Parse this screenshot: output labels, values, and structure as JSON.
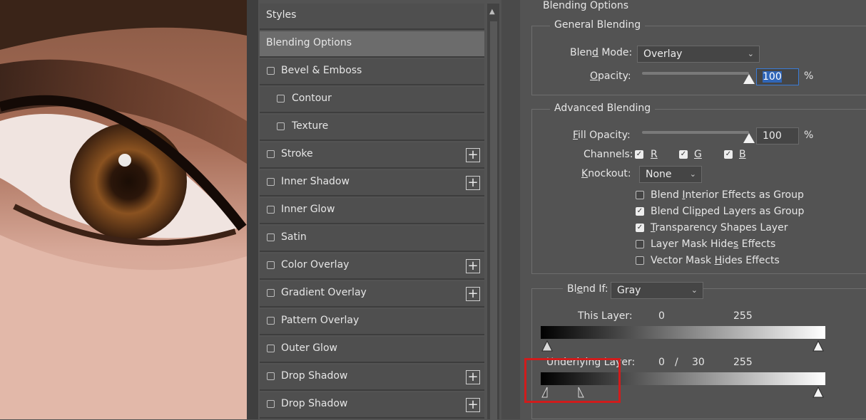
{
  "styles_list": {
    "items": [
      {
        "label": "Styles",
        "checkbox": false,
        "indent": false,
        "plus": false,
        "selected": false
      },
      {
        "label": "Blending Options",
        "checkbox": false,
        "indent": false,
        "plus": false,
        "selected": true
      },
      {
        "label": "Bevel & Emboss",
        "checkbox": true,
        "indent": false,
        "plus": false,
        "selected": false
      },
      {
        "label": "Contour",
        "checkbox": true,
        "indent": true,
        "plus": false,
        "selected": false
      },
      {
        "label": "Texture",
        "checkbox": true,
        "indent": true,
        "plus": false,
        "selected": false
      },
      {
        "label": "Stroke",
        "checkbox": true,
        "indent": false,
        "plus": true,
        "selected": false
      },
      {
        "label": "Inner Shadow",
        "checkbox": true,
        "indent": false,
        "plus": true,
        "selected": false
      },
      {
        "label": "Inner Glow",
        "checkbox": true,
        "indent": false,
        "plus": false,
        "selected": false
      },
      {
        "label": "Satin",
        "checkbox": true,
        "indent": false,
        "plus": false,
        "selected": false
      },
      {
        "label": "Color Overlay",
        "checkbox": true,
        "indent": false,
        "plus": true,
        "selected": false
      },
      {
        "label": "Gradient Overlay",
        "checkbox": true,
        "indent": false,
        "plus": true,
        "selected": false
      },
      {
        "label": "Pattern Overlay",
        "checkbox": true,
        "indent": false,
        "plus": false,
        "selected": false
      },
      {
        "label": "Outer Glow",
        "checkbox": true,
        "indent": false,
        "plus": false,
        "selected": false
      },
      {
        "label": "Drop Shadow",
        "checkbox": true,
        "indent": false,
        "plus": true,
        "selected": false
      },
      {
        "label": "Drop Shadow",
        "checkbox": true,
        "indent": false,
        "plus": true,
        "selected": false
      }
    ],
    "plus_symbol": "+"
  },
  "panel": {
    "title": "Blending Options",
    "general": {
      "legend": "General Blending",
      "blend_mode_label_pre": "Blen",
      "blend_mode_label_u": "d",
      "blend_mode_label_post": " Mode:",
      "blend_mode_value": "Overlay",
      "opacity_label_u": "O",
      "opacity_label_post": "pacity:",
      "opacity_value": "100",
      "opacity_unit": "%",
      "opacity_level": 1.0
    },
    "advanced": {
      "legend": "Advanced Blending",
      "fill_opacity_label_u": "F",
      "fill_opacity_label_post": "ill Opacity:",
      "fill_opacity_value": "100",
      "fill_opacity_unit": "%",
      "fill_opacity_level": 1.0,
      "channels_label": "Channels:",
      "channel_r": "R",
      "channel_g": "G",
      "channel_b": "B",
      "knockout_label_u": "K",
      "knockout_label_post": "nockout:",
      "knockout_value": "None",
      "options": [
        {
          "pre": "Blend ",
          "u": "I",
          "post": "nterior Effects as Group",
          "checked": false
        },
        {
          "pre": "Blend Cli",
          "u": "p",
          "post": "ped Layers as Group",
          "checked": true
        },
        {
          "pre": "",
          "u": "T",
          "post": "ransparency Shapes Layer",
          "checked": true
        },
        {
          "pre": "Layer Mask Hide",
          "u": "s",
          "post": " Effects",
          "checked": false
        },
        {
          "pre": "Vector Mask ",
          "u": "H",
          "post": "ides Effects",
          "checked": false
        }
      ]
    },
    "blend_if": {
      "label_pre": "Bl",
      "label_u": "e",
      "label_post": "nd If:",
      "value": "Gray",
      "this_layer_label": "This Layer:",
      "this_layer_low": "0",
      "this_layer_high": "255",
      "underlying_label": "Underlying Layer:",
      "underlying_low": "0",
      "underlying_sep": "/",
      "underlying_low_split": "30",
      "underlying_high": "255"
    }
  },
  "colors": {
    "highlight": "#d01c1c",
    "selection": "#3066b8"
  },
  "icons": {
    "chevron": "chevron-down-icon",
    "check": "check-icon",
    "plus": "plus-icon",
    "scroll_up": "scroll-up-arrow-icon"
  }
}
